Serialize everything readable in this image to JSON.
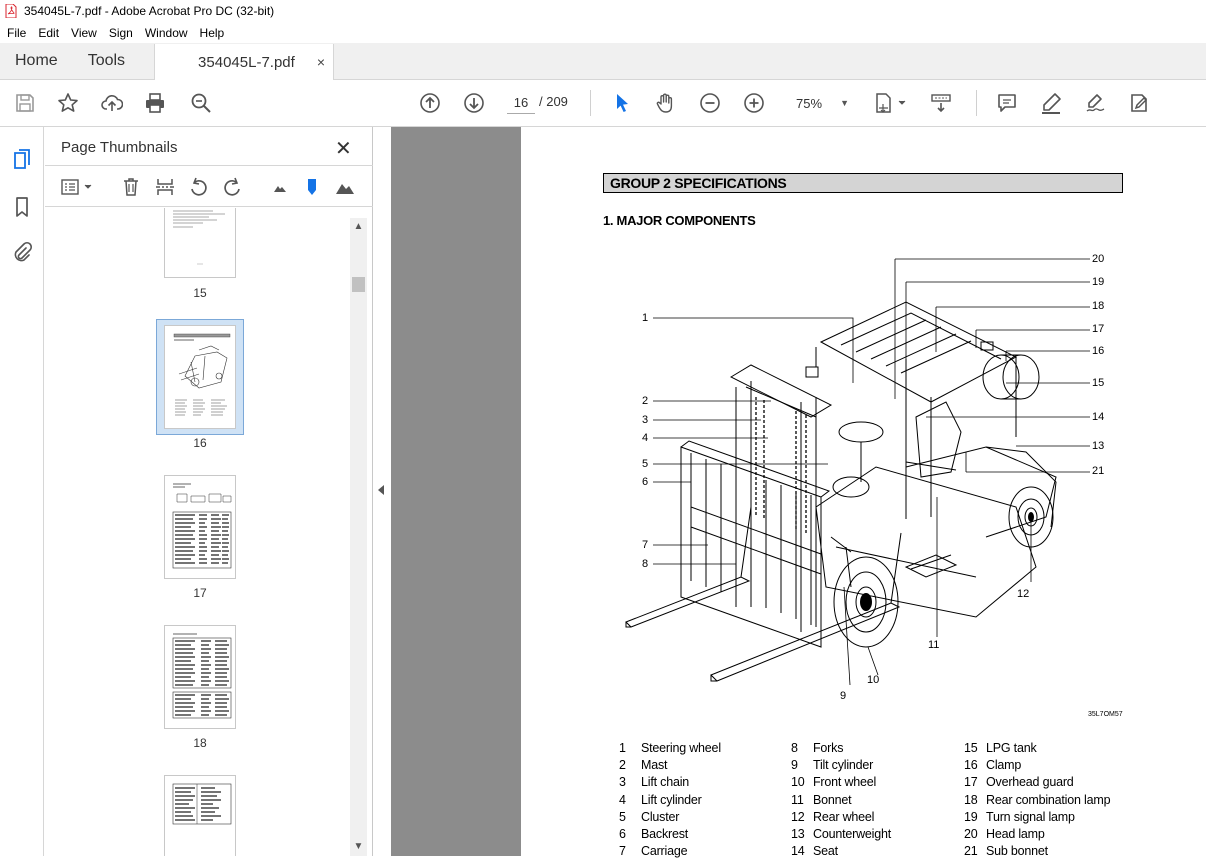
{
  "window": {
    "title": "354045L-7.pdf - Adobe Acrobat Pro DC (32-bit)"
  },
  "menu": [
    "File",
    "Edit",
    "View",
    "Sign",
    "Window",
    "Help"
  ],
  "tabs": {
    "home": "Home",
    "tools": "Tools",
    "document": "354045L-7.pdf",
    "close": "×"
  },
  "toolbar": {
    "current_page": "16",
    "page_total": "/  209",
    "zoom": "75%"
  },
  "panel": {
    "title": "Page Thumbnails",
    "close": "✕",
    "thumbnails": [
      {
        "label": "15"
      },
      {
        "label": "16",
        "selected": true
      },
      {
        "label": "17"
      },
      {
        "label": "18"
      }
    ]
  },
  "document": {
    "group_heading": "GROUP 2  SPECIFICATIONS",
    "section_heading": "1. MAJOR COMPONENTS",
    "figure_code": "35L7OM57",
    "callouts": [
      "1",
      "2",
      "3",
      "4",
      "5",
      "6",
      "7",
      "8",
      "9",
      "10",
      "11",
      "12",
      "13",
      "14",
      "15",
      "16",
      "17",
      "18",
      "19",
      "20",
      "21"
    ],
    "components": [
      {
        "num": "1",
        "name": "Steering wheel"
      },
      {
        "num": "2",
        "name": "Mast"
      },
      {
        "num": "3",
        "name": "Lift chain"
      },
      {
        "num": "4",
        "name": "Lift cylinder"
      },
      {
        "num": "5",
        "name": "Cluster"
      },
      {
        "num": "6",
        "name": "Backrest"
      },
      {
        "num": "7",
        "name": "Carriage"
      },
      {
        "num": "8",
        "name": "Forks"
      },
      {
        "num": "9",
        "name": "Tilt cylinder"
      },
      {
        "num": "10",
        "name": "Front wheel"
      },
      {
        "num": "11",
        "name": "Bonnet"
      },
      {
        "num": "12",
        "name": "Rear wheel"
      },
      {
        "num": "13",
        "name": "Counterweight"
      },
      {
        "num": "14",
        "name": "Seat"
      },
      {
        "num": "15",
        "name": "LPG tank"
      },
      {
        "num": "16",
        "name": "Clamp"
      },
      {
        "num": "17",
        "name": "Overhead guard"
      },
      {
        "num": "18",
        "name": "Rear combination lamp"
      },
      {
        "num": "19",
        "name": "Turn signal lamp"
      },
      {
        "num": "20",
        "name": "Head lamp"
      },
      {
        "num": "21",
        "name": "Sub bonnet"
      }
    ]
  },
  "colors": {
    "accent": "#1473e6",
    "pdf_red": "#d9232d",
    "viewer_bg": "#8c8c8c",
    "selection": "#cfe2f5"
  }
}
